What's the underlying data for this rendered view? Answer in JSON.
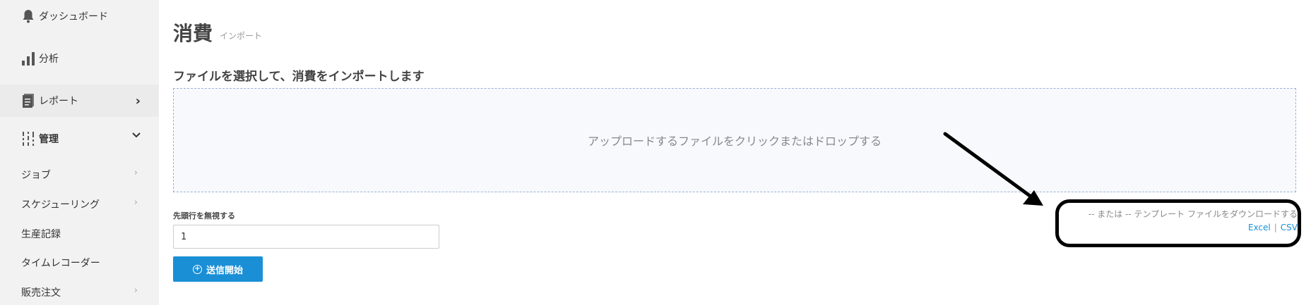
{
  "sidebar": {
    "items": [
      {
        "label": "ダッシュボード",
        "icon": "bell-icon"
      },
      {
        "label": "分析",
        "icon": "bar-chart-icon"
      },
      {
        "label": "レポート",
        "icon": "report-icon",
        "chevron": "›"
      },
      {
        "label": "管理",
        "icon": "management-icon",
        "chevron": "⌄"
      }
    ],
    "sub_items": [
      {
        "label": "ジョブ",
        "chevron": "›"
      },
      {
        "label": "スケジューリング",
        "chevron": "›"
      },
      {
        "label": "生産記録"
      },
      {
        "label": "タイムレコーダー"
      },
      {
        "label": "販売注文",
        "chevron": "›"
      }
    ]
  },
  "page": {
    "title": "消費",
    "subtitle": "インポート",
    "section_heading": "ファイルを選択して、消費をインポートします",
    "dropzone_text": "アップロードするファイルをクリックまたはドロップする",
    "skip_label": "先頭行を無視する",
    "skip_value": "1",
    "submit_label": "送信開始"
  },
  "template": {
    "text": "-- または -- テンプレート ファイルをダウンロードする",
    "excel_label": "Excel",
    "separator": "|",
    "csv_label": "CSV"
  },
  "colors": {
    "accent": "#1a8fd6",
    "sidebar_bg": "#f2f2f2",
    "dropzone_border": "#9ab3d6"
  }
}
